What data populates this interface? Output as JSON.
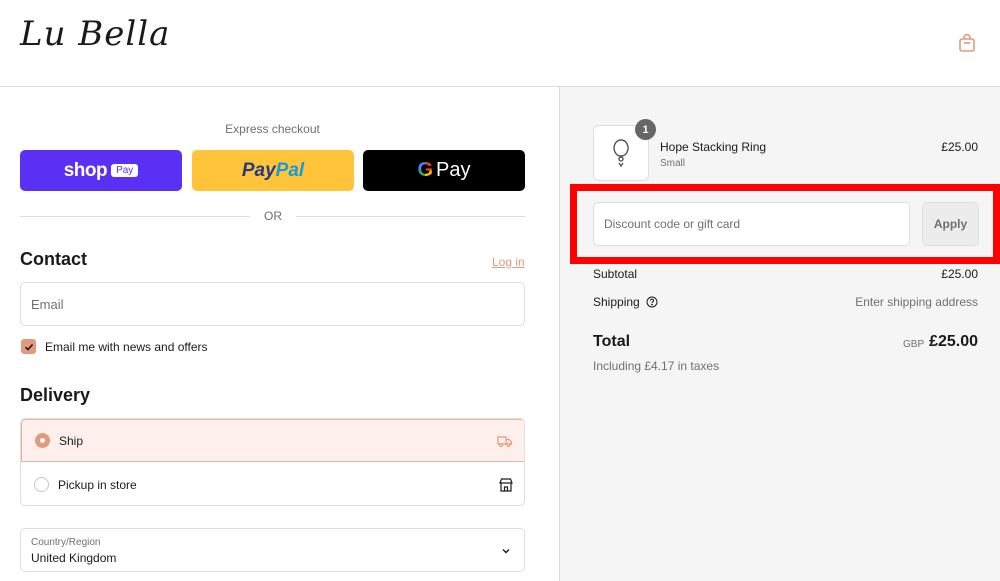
{
  "header": {
    "logo_text": "Lu Bella",
    "cart_icon": "shopping-bag-icon"
  },
  "express": {
    "label": "Express checkout",
    "shop_pay": {
      "word": "shop",
      "badge": "Pay"
    },
    "paypal": {
      "part1": "Pay",
      "part2": "Pal"
    },
    "google_pay": {
      "g": "G",
      "word": "Pay"
    },
    "or_text": "OR"
  },
  "contact": {
    "title": "Contact",
    "login_label": "Log in",
    "email_placeholder": "Email",
    "news_label": "Email me with news and offers",
    "news_checked": true
  },
  "delivery": {
    "title": "Delivery",
    "options": [
      {
        "label": "Ship",
        "selected": true,
        "icon": "truck-icon"
      },
      {
        "label": "Pickup in store",
        "selected": false,
        "icon": "store-icon"
      }
    ],
    "country": {
      "label": "Country/Region",
      "value": "United Kingdom"
    }
  },
  "summary": {
    "product": {
      "name": "Hope Stacking Ring",
      "variant": "Small",
      "price": "£25.00",
      "quantity": "1"
    },
    "discount_placeholder": "Discount code or gift card",
    "apply_label": "Apply",
    "subtotal_label": "Subtotal",
    "subtotal_value": "£25.00",
    "shipping_label": "Shipping",
    "shipping_value": "Enter shipping address",
    "total_label": "Total",
    "currency": "GBP",
    "total_value": "£25.00",
    "tax_note": "Including £4.17 in taxes"
  },
  "colors": {
    "accent": "#e29a7e",
    "shop_pay": "#5a31f4",
    "paypal": "#ffc439",
    "highlight": "#ff0000"
  }
}
